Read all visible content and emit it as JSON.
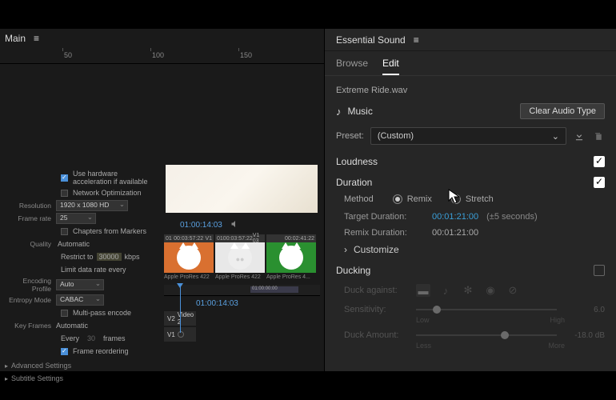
{
  "left": {
    "title": "Main",
    "ruler": [
      "50",
      "100",
      "150"
    ],
    "export": {
      "hw_accel": "Use hardware acceleration if available",
      "net_opt": "Network Optimization",
      "resolution_label": "Resolution",
      "resolution": "1920 x 1080 HD",
      "framerate_label": "Frame rate",
      "framerate": "25",
      "chapters": "Chapters from Markers",
      "quality_label": "Quality",
      "quality_auto": "Automatic",
      "restrict": "Restrict to",
      "restrict_val": "30000",
      "restrict_unit": "kbps",
      "limit": "Limit data rate every",
      "enc_profile_label": "Encoding Profile",
      "enc_profile": "Auto",
      "entropy_label": "Entropy Mode",
      "entropy": "CABAC",
      "multipass": "Multi-pass encode",
      "keyframes_label": "Key Frames",
      "kf_auto": "Automatic",
      "kf_every": "Every",
      "kf_frames": "frames",
      "reorder": "Frame reordering",
      "advanced": "Advanced Settings",
      "subtitle": "Subtitle Settings"
    },
    "preview_time": "01:00:14:03",
    "clips": [
      {
        "tc": "00:03:57:22",
        "v": "V1",
        "codec": "Apple ProRes 422"
      },
      {
        "tc": "00:03:57:22",
        "v": "V1 03",
        "codec": "Apple ProRes 422"
      },
      {
        "tc": "00:02:41:22",
        "v": "",
        "codec": "Apple ProRes 4..."
      }
    ],
    "timeline_time": "01:00:14:03",
    "track_v2": "V2",
    "track_v2_name": "Video 2",
    "track_v1": "V1",
    "tl_clip_tc": "01:00:00:00"
  },
  "es": {
    "panel_title": "Essential Sound",
    "tabs": {
      "browse": "Browse",
      "edit": "Edit"
    },
    "filename": "Extreme Ride.wav",
    "assignment": "Music",
    "clear_btn": "Clear Audio Type",
    "preset_label": "Preset:",
    "preset_value": "(Custom)",
    "loudness": {
      "title": "Loudness"
    },
    "duration": {
      "title": "Duration",
      "method_label": "Method",
      "remix": "Remix",
      "stretch": "Stretch",
      "target_label": "Target Duration:",
      "target_value": "00:01:21:00",
      "tolerance": "(±5 seconds)",
      "remix_label": "Remix Duration:",
      "remix_value": "00:01:21:00",
      "customize": "Customize"
    },
    "ducking": {
      "title": "Ducking",
      "against": "Duck against:",
      "sensitivity_label": "Sensitivity:",
      "sensitivity_val": "6.0",
      "sens_low": "Low",
      "sens_high": "High",
      "amount_label": "Duck Amount:",
      "amount_val": "-18.0 dB",
      "amt_less": "Less",
      "amt_more": "More"
    }
  }
}
